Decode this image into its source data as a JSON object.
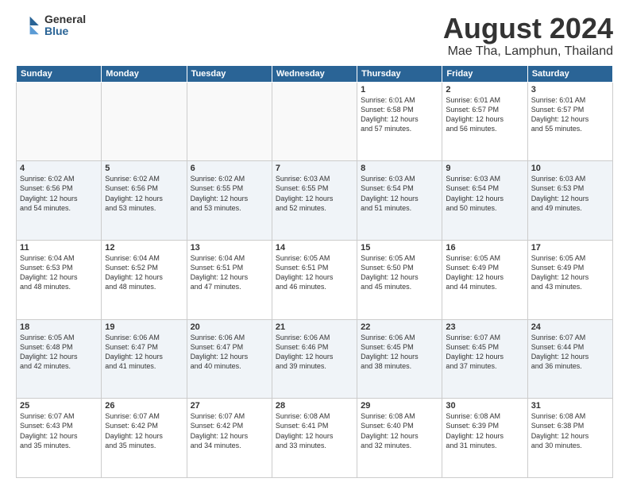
{
  "header": {
    "logo_general": "General",
    "logo_blue": "Blue",
    "main_title": "August 2024",
    "subtitle": "Mae Tha, Lamphun, Thailand"
  },
  "calendar": {
    "days_of_week": [
      "Sunday",
      "Monday",
      "Tuesday",
      "Wednesday",
      "Thursday",
      "Friday",
      "Saturday"
    ],
    "weeks": [
      [
        {
          "day": "",
          "info": ""
        },
        {
          "day": "",
          "info": ""
        },
        {
          "day": "",
          "info": ""
        },
        {
          "day": "",
          "info": ""
        },
        {
          "day": "1",
          "info": "Sunrise: 6:01 AM\nSunset: 6:58 PM\nDaylight: 12 hours\nand 57 minutes."
        },
        {
          "day": "2",
          "info": "Sunrise: 6:01 AM\nSunset: 6:57 PM\nDaylight: 12 hours\nand 56 minutes."
        },
        {
          "day": "3",
          "info": "Sunrise: 6:01 AM\nSunset: 6:57 PM\nDaylight: 12 hours\nand 55 minutes."
        }
      ],
      [
        {
          "day": "4",
          "info": "Sunrise: 6:02 AM\nSunset: 6:56 PM\nDaylight: 12 hours\nand 54 minutes."
        },
        {
          "day": "5",
          "info": "Sunrise: 6:02 AM\nSunset: 6:56 PM\nDaylight: 12 hours\nand 53 minutes."
        },
        {
          "day": "6",
          "info": "Sunrise: 6:02 AM\nSunset: 6:55 PM\nDaylight: 12 hours\nand 53 minutes."
        },
        {
          "day": "7",
          "info": "Sunrise: 6:03 AM\nSunset: 6:55 PM\nDaylight: 12 hours\nand 52 minutes."
        },
        {
          "day": "8",
          "info": "Sunrise: 6:03 AM\nSunset: 6:54 PM\nDaylight: 12 hours\nand 51 minutes."
        },
        {
          "day": "9",
          "info": "Sunrise: 6:03 AM\nSunset: 6:54 PM\nDaylight: 12 hours\nand 50 minutes."
        },
        {
          "day": "10",
          "info": "Sunrise: 6:03 AM\nSunset: 6:53 PM\nDaylight: 12 hours\nand 49 minutes."
        }
      ],
      [
        {
          "day": "11",
          "info": "Sunrise: 6:04 AM\nSunset: 6:53 PM\nDaylight: 12 hours\nand 48 minutes."
        },
        {
          "day": "12",
          "info": "Sunrise: 6:04 AM\nSunset: 6:52 PM\nDaylight: 12 hours\nand 48 minutes."
        },
        {
          "day": "13",
          "info": "Sunrise: 6:04 AM\nSunset: 6:51 PM\nDaylight: 12 hours\nand 47 minutes."
        },
        {
          "day": "14",
          "info": "Sunrise: 6:05 AM\nSunset: 6:51 PM\nDaylight: 12 hours\nand 46 minutes."
        },
        {
          "day": "15",
          "info": "Sunrise: 6:05 AM\nSunset: 6:50 PM\nDaylight: 12 hours\nand 45 minutes."
        },
        {
          "day": "16",
          "info": "Sunrise: 6:05 AM\nSunset: 6:49 PM\nDaylight: 12 hours\nand 44 minutes."
        },
        {
          "day": "17",
          "info": "Sunrise: 6:05 AM\nSunset: 6:49 PM\nDaylight: 12 hours\nand 43 minutes."
        }
      ],
      [
        {
          "day": "18",
          "info": "Sunrise: 6:05 AM\nSunset: 6:48 PM\nDaylight: 12 hours\nand 42 minutes."
        },
        {
          "day": "19",
          "info": "Sunrise: 6:06 AM\nSunset: 6:47 PM\nDaylight: 12 hours\nand 41 minutes."
        },
        {
          "day": "20",
          "info": "Sunrise: 6:06 AM\nSunset: 6:47 PM\nDaylight: 12 hours\nand 40 minutes."
        },
        {
          "day": "21",
          "info": "Sunrise: 6:06 AM\nSunset: 6:46 PM\nDaylight: 12 hours\nand 39 minutes."
        },
        {
          "day": "22",
          "info": "Sunrise: 6:06 AM\nSunset: 6:45 PM\nDaylight: 12 hours\nand 38 minutes."
        },
        {
          "day": "23",
          "info": "Sunrise: 6:07 AM\nSunset: 6:45 PM\nDaylight: 12 hours\nand 37 minutes."
        },
        {
          "day": "24",
          "info": "Sunrise: 6:07 AM\nSunset: 6:44 PM\nDaylight: 12 hours\nand 36 minutes."
        }
      ],
      [
        {
          "day": "25",
          "info": "Sunrise: 6:07 AM\nSunset: 6:43 PM\nDaylight: 12 hours\nand 35 minutes."
        },
        {
          "day": "26",
          "info": "Sunrise: 6:07 AM\nSunset: 6:42 PM\nDaylight: 12 hours\nand 35 minutes."
        },
        {
          "day": "27",
          "info": "Sunrise: 6:07 AM\nSunset: 6:42 PM\nDaylight: 12 hours\nand 34 minutes."
        },
        {
          "day": "28",
          "info": "Sunrise: 6:08 AM\nSunset: 6:41 PM\nDaylight: 12 hours\nand 33 minutes."
        },
        {
          "day": "29",
          "info": "Sunrise: 6:08 AM\nSunset: 6:40 PM\nDaylight: 12 hours\nand 32 minutes."
        },
        {
          "day": "30",
          "info": "Sunrise: 6:08 AM\nSunset: 6:39 PM\nDaylight: 12 hours\nand 31 minutes."
        },
        {
          "day": "31",
          "info": "Sunrise: 6:08 AM\nSunset: 6:38 PM\nDaylight: 12 hours\nand 30 minutes."
        }
      ]
    ]
  }
}
